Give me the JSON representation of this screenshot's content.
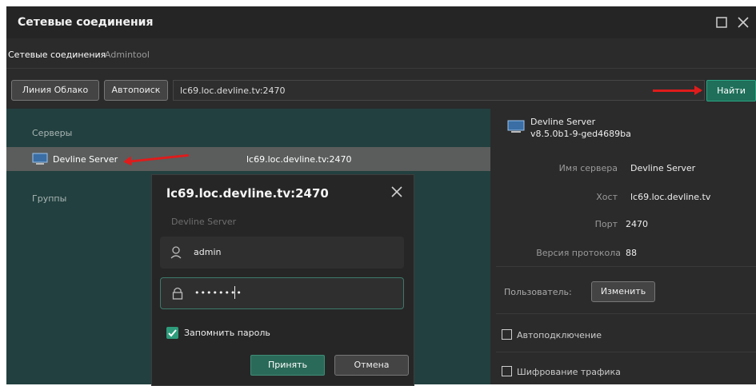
{
  "window": {
    "title": "Сетевые соединения",
    "maximize_icon": "square-icon",
    "close_icon": "x-icon"
  },
  "tabs": [
    {
      "label": "Сетевые соединения",
      "active": true
    },
    {
      "label": "Admintool",
      "active": false
    }
  ],
  "toolbar": {
    "cloud_button": "Линия Облако",
    "autosearch_button": "Автопоиск",
    "address_value": "lc69.loc.devline.tv:2470",
    "find_button": "Найти"
  },
  "left_panel": {
    "servers_label": "Серверы",
    "server_name": "Devline Server",
    "server_address": "lc69.loc.devline.tv:2470",
    "groups_label": "Группы"
  },
  "right_panel": {
    "server_title": "Devline Server",
    "server_version": "v8.5.0b1-9-ged4689ba",
    "fields": [
      {
        "label": "Имя сервера",
        "value": "Devline Server"
      },
      {
        "label": "Хост",
        "value": "lc69.loc.devline.tv"
      },
      {
        "label": "Порт",
        "value": "2470"
      },
      {
        "label": "Версия протокола",
        "value": "88"
      }
    ],
    "user_label": "Пользователь:",
    "change_button": "Изменить",
    "autoconnect_label": "Автоподключение",
    "encryption_label": "Шифрование трафика"
  },
  "dialog": {
    "title": "lc69.loc.devline.tv:2470",
    "subtitle": "Devline Server",
    "username": "admin",
    "password_mask": "••••••••",
    "remember_label": "Запомнить пароль",
    "remember_checked": true,
    "accept_button": "Принять",
    "cancel_button": "Отмена"
  },
  "colors": {
    "accent": "#1f6f5a",
    "panel_teal": "#22403f",
    "arrow_red": "#e01b1b"
  }
}
